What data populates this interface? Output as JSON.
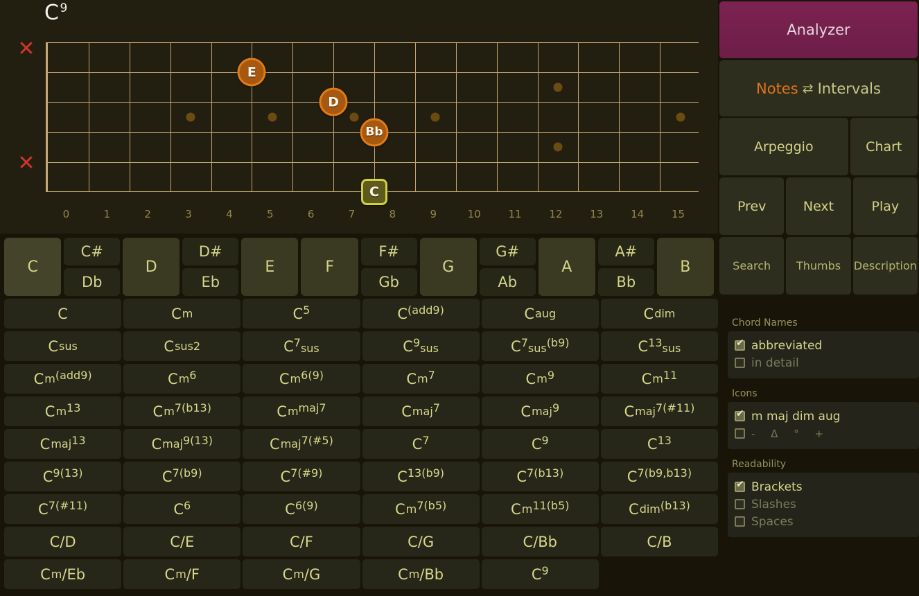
{
  "chord_title": {
    "root": "C",
    "ext": "9"
  },
  "fretboard": {
    "strings": 6,
    "frets": 16,
    "fret_numbers": [
      "0",
      "1",
      "2",
      "3",
      "4",
      "5",
      "6",
      "7",
      "8",
      "9",
      "10",
      "11",
      "12",
      "13",
      "14",
      "15"
    ],
    "mutes": [
      "X",
      "X"
    ],
    "inlay_frets": [
      3,
      5,
      7,
      9,
      12,
      12,
      15
    ],
    "markers": [
      {
        "label": "E",
        "type": "note",
        "string": 2,
        "fret": 5
      },
      {
        "label": "D",
        "type": "note",
        "string": 3,
        "fret": 7
      },
      {
        "label": "Bb",
        "type": "note",
        "string": 4,
        "fret": 8
      },
      {
        "label": "C",
        "type": "root",
        "string": 6,
        "fret": 8
      }
    ]
  },
  "note_keys": [
    {
      "natural": "C",
      "sharp": null,
      "flat": null,
      "selected": true
    },
    {
      "natural": null,
      "sharp": "C#",
      "flat": "Db",
      "selected": false
    },
    {
      "natural": "D",
      "sharp": null,
      "flat": null,
      "selected": false
    },
    {
      "natural": null,
      "sharp": "D#",
      "flat": "Eb",
      "selected": false
    },
    {
      "natural": "E",
      "sharp": null,
      "flat": null,
      "selected": false
    },
    {
      "natural": "F",
      "sharp": null,
      "flat": null,
      "selected": false
    },
    {
      "natural": null,
      "sharp": "F#",
      "flat": "Gb",
      "selected": false
    },
    {
      "natural": "G",
      "sharp": null,
      "flat": null,
      "selected": false
    },
    {
      "natural": null,
      "sharp": "G#",
      "flat": "Ab",
      "selected": false
    },
    {
      "natural": "A",
      "sharp": null,
      "flat": null,
      "selected": false
    },
    {
      "natural": null,
      "sharp": "A#",
      "flat": "Bb",
      "selected": false
    },
    {
      "natural": "B",
      "sharp": null,
      "flat": null,
      "selected": false
    }
  ],
  "chord_grid": [
    [
      {
        "root": "C",
        "qual": "",
        "sup": "",
        "sub": ""
      },
      {
        "root": "C",
        "qual": "m",
        "sup": "",
        "sub": ""
      },
      {
        "root": "C",
        "qual": "",
        "sup": "5",
        "sub": ""
      },
      {
        "root": "C",
        "qual": "",
        "sup": "(add9)",
        "sub": ""
      },
      {
        "root": "C",
        "qual": "aug",
        "sup": "",
        "sub": ""
      },
      {
        "root": "C",
        "qual": "dim",
        "sup": "",
        "sub": ""
      }
    ],
    [
      {
        "root": "C",
        "qual": "sus",
        "sup": "",
        "sub": ""
      },
      {
        "root": "C",
        "qual": "sus2",
        "sup": "",
        "sub": ""
      },
      {
        "root": "C",
        "qual": "",
        "sup": "7",
        "sub": "sus"
      },
      {
        "root": "C",
        "qual": "",
        "sup": "9",
        "sub": "sus"
      },
      {
        "root": "C",
        "qual": "",
        "sup": "7",
        "sub": "sus",
        "sup2": "(b9)"
      },
      {
        "root": "C",
        "qual": "",
        "sup": "13",
        "sub": "sus"
      }
    ],
    [
      {
        "root": "C",
        "qual": "m",
        "sup": "(add9)",
        "sub": ""
      },
      {
        "root": "C",
        "qual": "m",
        "sup": "6",
        "sub": ""
      },
      {
        "root": "C",
        "qual": "m",
        "sup": "6(9)",
        "sub": ""
      },
      {
        "root": "C",
        "qual": "m",
        "sup": "7",
        "sub": ""
      },
      {
        "root": "C",
        "qual": "m",
        "sup": "9",
        "sub": ""
      },
      {
        "root": "C",
        "qual": "m",
        "sup": "11",
        "sub": ""
      }
    ],
    [
      {
        "root": "C",
        "qual": "m",
        "sup": "13",
        "sub": ""
      },
      {
        "root": "C",
        "qual": "m",
        "sup": "7(b13)",
        "sub": ""
      },
      {
        "root": "C",
        "qual": "m",
        "sup": "maj7",
        "sub": ""
      },
      {
        "root": "C",
        "qual": "maj",
        "sup": "7",
        "sub": ""
      },
      {
        "root": "C",
        "qual": "maj",
        "sup": "9",
        "sub": ""
      },
      {
        "root": "C",
        "qual": "maj",
        "sup": "7(#11)",
        "sub": ""
      }
    ],
    [
      {
        "root": "C",
        "qual": "maj",
        "sup": "13",
        "sub": ""
      },
      {
        "root": "C",
        "qual": "maj",
        "sup": "9(13)",
        "sub": ""
      },
      {
        "root": "C",
        "qual": "maj",
        "sup": "7(#5)",
        "sub": ""
      },
      {
        "root": "C",
        "qual": "",
        "sup": "7",
        "sub": ""
      },
      {
        "root": "C",
        "qual": "",
        "sup": "9",
        "sub": ""
      },
      {
        "root": "C",
        "qual": "",
        "sup": "13",
        "sub": ""
      }
    ],
    [
      {
        "root": "C",
        "qual": "",
        "sup": "9(13)",
        "sub": ""
      },
      {
        "root": "C",
        "qual": "",
        "sup": "7(b9)",
        "sub": ""
      },
      {
        "root": "C",
        "qual": "",
        "sup": "7(#9)",
        "sub": ""
      },
      {
        "root": "C",
        "qual": "",
        "sup": "13(b9)",
        "sub": ""
      },
      {
        "root": "C",
        "qual": "",
        "sup": "7(b13)",
        "sub": ""
      },
      {
        "root": "C",
        "qual": "",
        "sup": "7(b9,b13)",
        "sub": ""
      }
    ],
    [
      {
        "root": "C",
        "qual": "",
        "sup": "7(#11)",
        "sub": ""
      },
      {
        "root": "C",
        "qual": "",
        "sup": "6",
        "sub": ""
      },
      {
        "root": "C",
        "qual": "",
        "sup": "6(9)",
        "sub": ""
      },
      {
        "root": "C",
        "qual": "m",
        "sup": "7(b5)",
        "sub": ""
      },
      {
        "root": "C",
        "qual": "m",
        "sup": "11(b5)",
        "sub": ""
      },
      {
        "root": "C",
        "qual": "dim",
        "sup": "(b13)",
        "sub": ""
      }
    ],
    [
      {
        "slash": "C/D"
      },
      {
        "slash": "C/E"
      },
      {
        "slash": "C/F"
      },
      {
        "slash": "C/G"
      },
      {
        "slash": "C/Bb"
      },
      {
        "slash": "C/B"
      }
    ],
    [
      {
        "root": "C",
        "qual": "m",
        "slash_tail": "/Eb"
      },
      {
        "root": "C",
        "qual": "m",
        "slash_tail": "/F"
      },
      {
        "root": "C",
        "qual": "m",
        "slash_tail": "/G"
      },
      {
        "root": "C",
        "qual": "m",
        "slash_tail": "/Bb"
      },
      {
        "root": "C",
        "qual": "",
        "sup": "9",
        "sub": ""
      },
      {
        "empty": true
      }
    ]
  ],
  "sidebar": {
    "analyzer": "Analyzer",
    "toggle": {
      "on": "Notes",
      "swap": "⇄",
      "off": "Intervals"
    },
    "arpeggio": "Arpeggio",
    "chart": "Chart",
    "prev": "Prev",
    "next": "Next",
    "play": "Play",
    "search": "Search",
    "thumbs": "Thumbs",
    "description": "Description"
  },
  "settings": {
    "chord_names": {
      "title": "Chord Names",
      "options": [
        {
          "label": "abbreviated",
          "checked": true
        },
        {
          "label": "in detail",
          "checked": false
        }
      ]
    },
    "icons": {
      "title": "Icons",
      "options": [
        {
          "label": "m maj dim aug",
          "checked": true
        },
        {
          "label": "-  Δ  °  +",
          "checked": false
        }
      ]
    },
    "readability": {
      "title": "Readability",
      "options": [
        {
          "label": "Brackets",
          "checked": true
        },
        {
          "label": "Slashes",
          "checked": false
        },
        {
          "label": "Spaces",
          "checked": false
        }
      ]
    }
  },
  "colors": {
    "accent_magenta": "#7c2251",
    "note_orange": "#e07b18",
    "root_yellow": "#cfd23a",
    "mute_red": "#d0352a",
    "text_olive": "#d4d48a"
  }
}
